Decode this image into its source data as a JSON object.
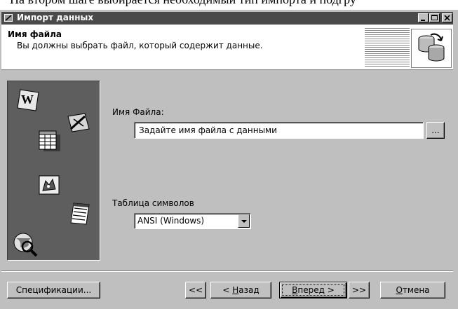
{
  "document": {
    "caption_fragment": "На втором шаге выбирается необходимый тип импорта и подгру"
  },
  "window": {
    "title": "Импорт данных",
    "controls": {
      "minimize": "_",
      "maximize": "□",
      "close": "x"
    }
  },
  "header": {
    "title": "Имя файла",
    "subtitle": "Вы должны выбрать файл, который содержит данные.",
    "icon": "database-sync-icon"
  },
  "sidebar": {
    "icons": [
      "word-document-icon",
      "pen-tool-icon",
      "spreadsheet-icon",
      "foxpro-icon",
      "notepad-icon",
      "globe-search-icon"
    ]
  },
  "form": {
    "file_label": "Имя Файла:",
    "file_value": "Задайте имя файла с данными",
    "browse_label": "...",
    "charset_label": "Таблица символов",
    "charset_selected": "ANSI (Windows)"
  },
  "footer": {
    "spec_label": "Спецификации...",
    "first_label": "<<",
    "back_accel": "Н",
    "back_rest": "азад",
    "back_prefix": "< ",
    "next_accel": "В",
    "next_rest": "перед >",
    "last_label": ">>",
    "cancel_accel": "О",
    "cancel_rest": "тмена"
  },
  "colors": {
    "titlebar": "#4a4a4a",
    "dialog": "#bfbfbf",
    "sidebar": "#5e5e5e"
  }
}
